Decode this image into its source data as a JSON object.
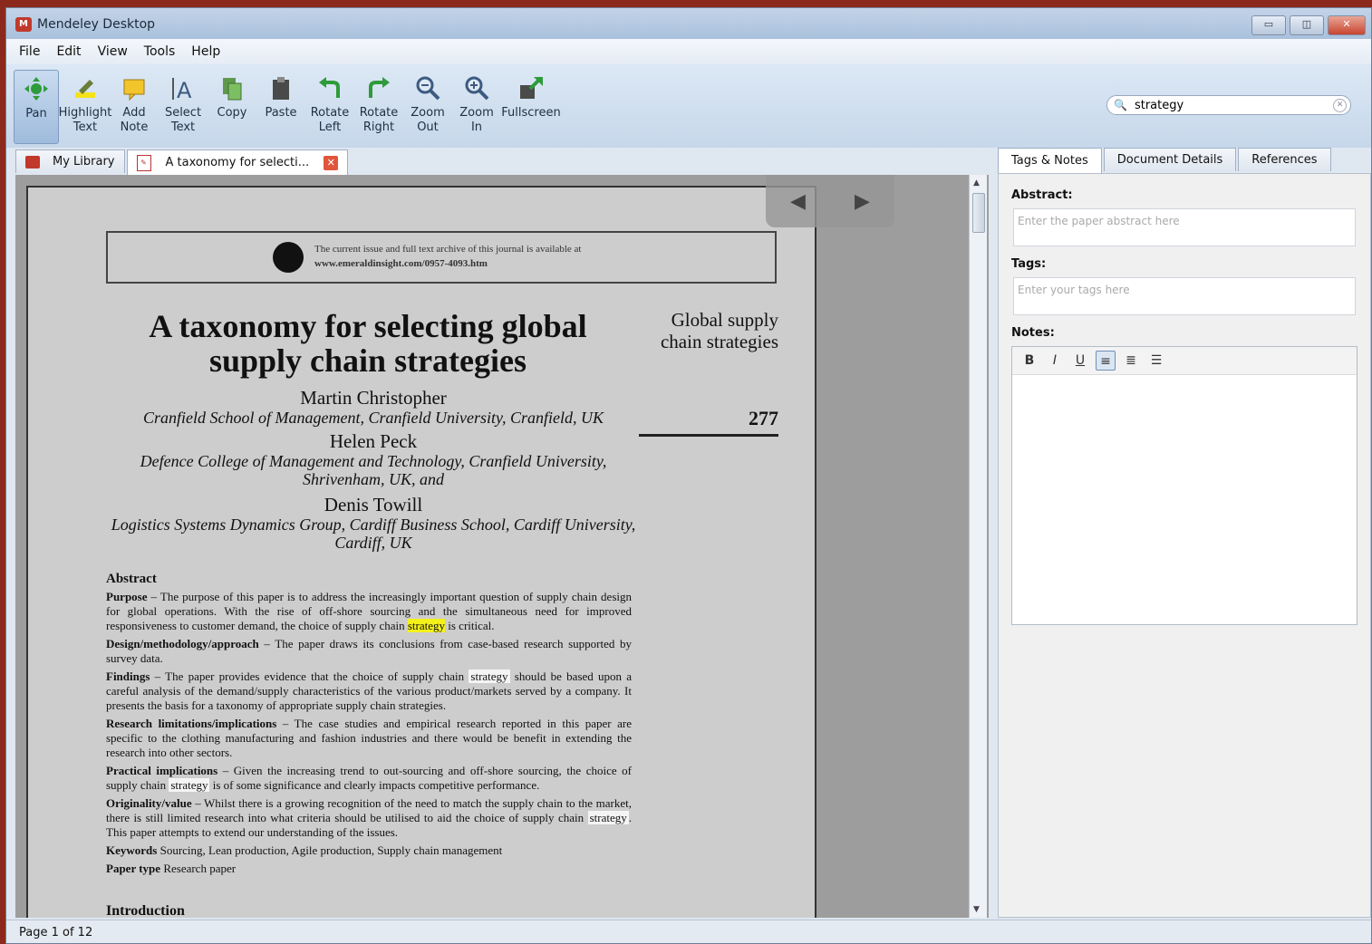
{
  "window": {
    "title": "Mendeley Desktop",
    "minimize": "▭",
    "maximize": "◫",
    "close": "✕"
  },
  "menu": [
    "File",
    "Edit",
    "View",
    "Tools",
    "Help"
  ],
  "toolbar": {
    "tools": [
      {
        "label1": "Pan",
        "label2": "",
        "icon": "pan-icon"
      },
      {
        "label1": "Highlight",
        "label2": "Text",
        "icon": "highlight-icon"
      },
      {
        "label1": "Add",
        "label2": "Note",
        "icon": "note-icon"
      },
      {
        "label1": "Select",
        "label2": "Text",
        "icon": "select-text-icon"
      },
      {
        "label1": "Copy",
        "label2": "",
        "icon": "copy-icon"
      },
      {
        "label1": "Paste",
        "label2": "",
        "icon": "paste-icon"
      },
      {
        "label1": "Rotate",
        "label2": "Left",
        "icon": "rotate-left-icon"
      },
      {
        "label1": "Rotate",
        "label2": "Right",
        "icon": "rotate-right-icon"
      },
      {
        "label1": "Zoom",
        "label2": "Out",
        "icon": "zoom-out-icon"
      },
      {
        "label1": "Zoom",
        "label2": "In",
        "icon": "zoom-in-icon"
      },
      {
        "label1": "Fullscreen",
        "label2": "",
        "icon": "fullscreen-icon"
      }
    ],
    "search_value": "strategy"
  },
  "tabs": {
    "library": "My Library",
    "document": "A taxonomy for selecti..."
  },
  "document": {
    "banner_line1": "The current issue and full text archive of this journal is available at",
    "banner_line2": "www.emeraldinsight.com/0957-4093.htm",
    "title": "A taxonomy for selecting global supply chain strategies",
    "side_label": "Global supply chain strategies",
    "page_number": "277",
    "authors": [
      {
        "name": "Martin Christopher",
        "affil": "Cranfield School of Management, Cranfield University, Cranfield, UK"
      },
      {
        "name": "Helen Peck",
        "affil": "Defence College of Management and Technology, Cranfield University, Shrivenham, UK, and"
      },
      {
        "name": "Denis Towill",
        "affil": "Logistics Systems Dynamics Group, Cardiff Business School, Cardiff University, Cardiff, UK"
      }
    ],
    "abstract_heading": "Abstract",
    "purpose_label": "Purpose",
    "purpose_text": " – The purpose of this paper is to address the increasingly important question of supply chain design for global operations. With the rise of off-shore sourcing and the simultaneous need for improved responsiveness to customer demand, the choice of supply chain ",
    "purpose_hl": "strategy",
    "purpose_end": " is critical.",
    "design_label": "Design/methodology/approach",
    "design_text": " – The paper draws its conclusions from case-based research supported by survey data.",
    "findings_label": "Findings",
    "findings_text": " – The paper provides evidence that the choice of supply chain ",
    "findings_hl": "strategy",
    "findings_end": " should be based upon a careful analysis of the demand/supply characteristics of the various product/markets served by a company. It presents the basis for a taxonomy of appropriate supply chain strategies.",
    "research_label": "Research limitations/implications",
    "research_text": " – The case studies and empirical research reported in this paper are specific to the clothing manufacturing and fashion industries and there would be benefit in extending the research into other sectors.",
    "practical_label": "Practical implications",
    "practical_text": " – Given the increasing trend to out-sourcing and off-shore sourcing, the choice of supply chain ",
    "practical_hl": "strategy",
    "practical_end": " is of some significance and clearly impacts competitive performance.",
    "orig_label": "Originality/value",
    "orig_text": " – Whilst there is a growing recognition of the need to match the supply chain to the market, there is still limited research into what criteria should be utilised to aid the choice of supply chain ",
    "orig_hl": "strategy",
    "orig_end": ". This paper attempts to extend our understanding of the issues.",
    "keywords_label": "Keywords",
    "keywords_text": " Sourcing, Lean production, Agile production, Supply chain management",
    "ptype_label": "Paper type",
    "ptype_text": " Research paper",
    "intro": "Introduction"
  },
  "right_panel": {
    "tabs": [
      "Tags & Notes",
      "Document Details",
      "References"
    ],
    "abstract_label": "Abstract:",
    "abstract_placeholder": "Enter the paper abstract here",
    "tags_label": "Tags:",
    "tags_placeholder": "Enter your tags here",
    "notes_label": "Notes:",
    "format_buttons": [
      "B",
      "I",
      "U",
      "≡",
      "≣",
      "☰"
    ]
  },
  "status": "Page 1 of 12"
}
